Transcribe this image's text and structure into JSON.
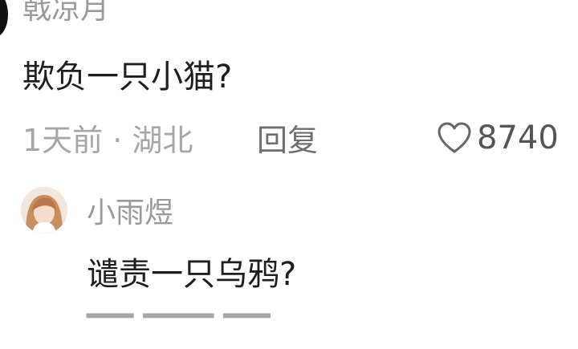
{
  "comment": {
    "username": "戟凉月",
    "text": "欺负一只小猫?",
    "time_location": "1天前 · 湖北",
    "reply_label": "回复",
    "like_icon": "heart-icon",
    "like_count": "8740"
  },
  "reply": {
    "username": "小雨煜",
    "text": "谴责一只乌鸦?"
  },
  "colors": {
    "background": "#ffffff",
    "username": "#9a9a9a",
    "text": "#1e1e1e",
    "meta": "#a6a6a6",
    "reply": "#6e6e6e"
  }
}
